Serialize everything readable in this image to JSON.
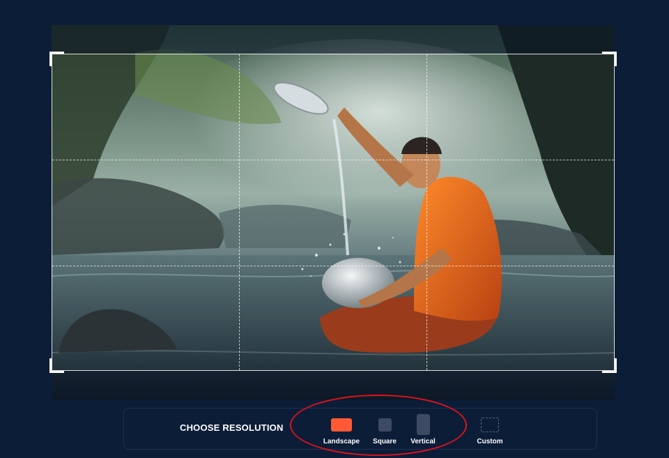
{
  "editor": {
    "photo_description_icon": "monk-river-photo"
  },
  "toolbar": {
    "choose_label": "CHOOSE RESOLUTION",
    "options": [
      {
        "label": "Landscape",
        "icon": "landscape-icon",
        "selected": true,
        "color": "#ff5a36"
      },
      {
        "label": "Square",
        "icon": "square-icon",
        "selected": false,
        "color": "#3c4a64"
      },
      {
        "label": "Vertical",
        "icon": "vertical-icon",
        "selected": false,
        "color": "#3c4a64"
      },
      {
        "label": "Custom",
        "icon": "custom-dashed-icon",
        "selected": false,
        "color": "#5e6b84"
      }
    ]
  },
  "colors": {
    "background": "#0c1d38",
    "accent": "#ff5a36",
    "annotation": "#e1121b"
  }
}
